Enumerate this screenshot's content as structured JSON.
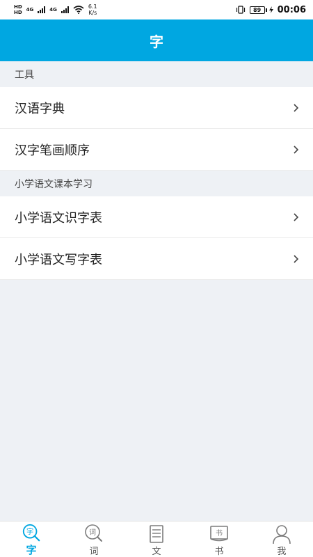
{
  "status_bar": {
    "hd1": "HD",
    "hd2": "HD",
    "sig1_label": "4G",
    "sig2_label": "4G",
    "net_speed_value": "6.1",
    "net_speed_unit": "K/s",
    "battery": "89",
    "time": "00:06"
  },
  "header": {
    "title": "字"
  },
  "sections": [
    {
      "title": "工具",
      "items": [
        {
          "label": "汉语字典"
        },
        {
          "label": "汉字笔画顺序"
        }
      ]
    },
    {
      "title": "小学语文课本学习",
      "items": [
        {
          "label": "小学语文识字表"
        },
        {
          "label": "小学语文写字表"
        }
      ]
    }
  ],
  "bottom_nav": {
    "items": [
      {
        "label": "字",
        "icon": "zi-search-icon",
        "active": true,
        "glyph": "字"
      },
      {
        "label": "词",
        "icon": "ci-search-icon",
        "active": false,
        "glyph": "词"
      },
      {
        "label": "文",
        "icon": "document-icon",
        "active": false
      },
      {
        "label": "书",
        "icon": "book-icon",
        "active": false,
        "glyph": "书"
      },
      {
        "label": "我",
        "icon": "user-icon",
        "active": false
      }
    ]
  },
  "colors": {
    "accent": "#00a7e1",
    "background": "#eef1f5",
    "inactive_icon": "#7b7b7b"
  }
}
